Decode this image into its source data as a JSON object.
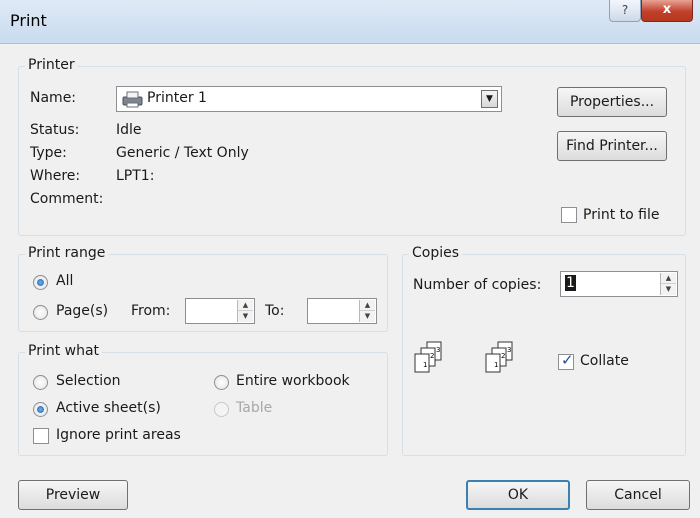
{
  "window": {
    "title": "Print",
    "help_glyph": "?",
    "close_glyph": "x"
  },
  "printer": {
    "legend": "Printer",
    "name_label": "Name:",
    "name_value": "Printer 1",
    "name_icon": "printer-icon",
    "status_label": "Status:",
    "status_value": "Idle",
    "type_label": "Type:",
    "type_value": "Generic / Text Only",
    "where_label": "Where:",
    "where_value": "LPT1:",
    "comment_label": "Comment:",
    "comment_value": "",
    "properties_label": "Properties...",
    "find_printer_label": "Find Printer...",
    "print_to_file_label": "Print to file",
    "print_to_file_checked": false
  },
  "print_range": {
    "legend": "Print range",
    "all_label": "All",
    "all_selected": true,
    "pages_label": "Page(s)",
    "from_label": "From:",
    "from_value": "",
    "to_label": "To:",
    "to_value": ""
  },
  "copies": {
    "legend": "Copies",
    "number_label": "Number of copies:",
    "number_value": "1",
    "collate_label": "Collate",
    "collate_checked": true,
    "collate_icon": "collate-pages-icon",
    "page_numbers": [
      "1",
      "2",
      "3"
    ]
  },
  "print_what": {
    "legend": "Print what",
    "selection_label": "Selection",
    "entire_workbook_label": "Entire workbook",
    "active_sheets_label": "Active sheet(s)",
    "active_sheets_selected": true,
    "table_label": "Table",
    "table_disabled": true,
    "ignore_print_areas_label": "Ignore print areas",
    "ignore_print_areas_checked": false
  },
  "buttons": {
    "preview_label": "Preview",
    "ok_label": "OK",
    "cancel_label": "Cancel"
  },
  "colors": {
    "titlebar": "#c9dbee",
    "close_button": "#c1402b",
    "default_button_border": "#3c7fb1"
  }
}
